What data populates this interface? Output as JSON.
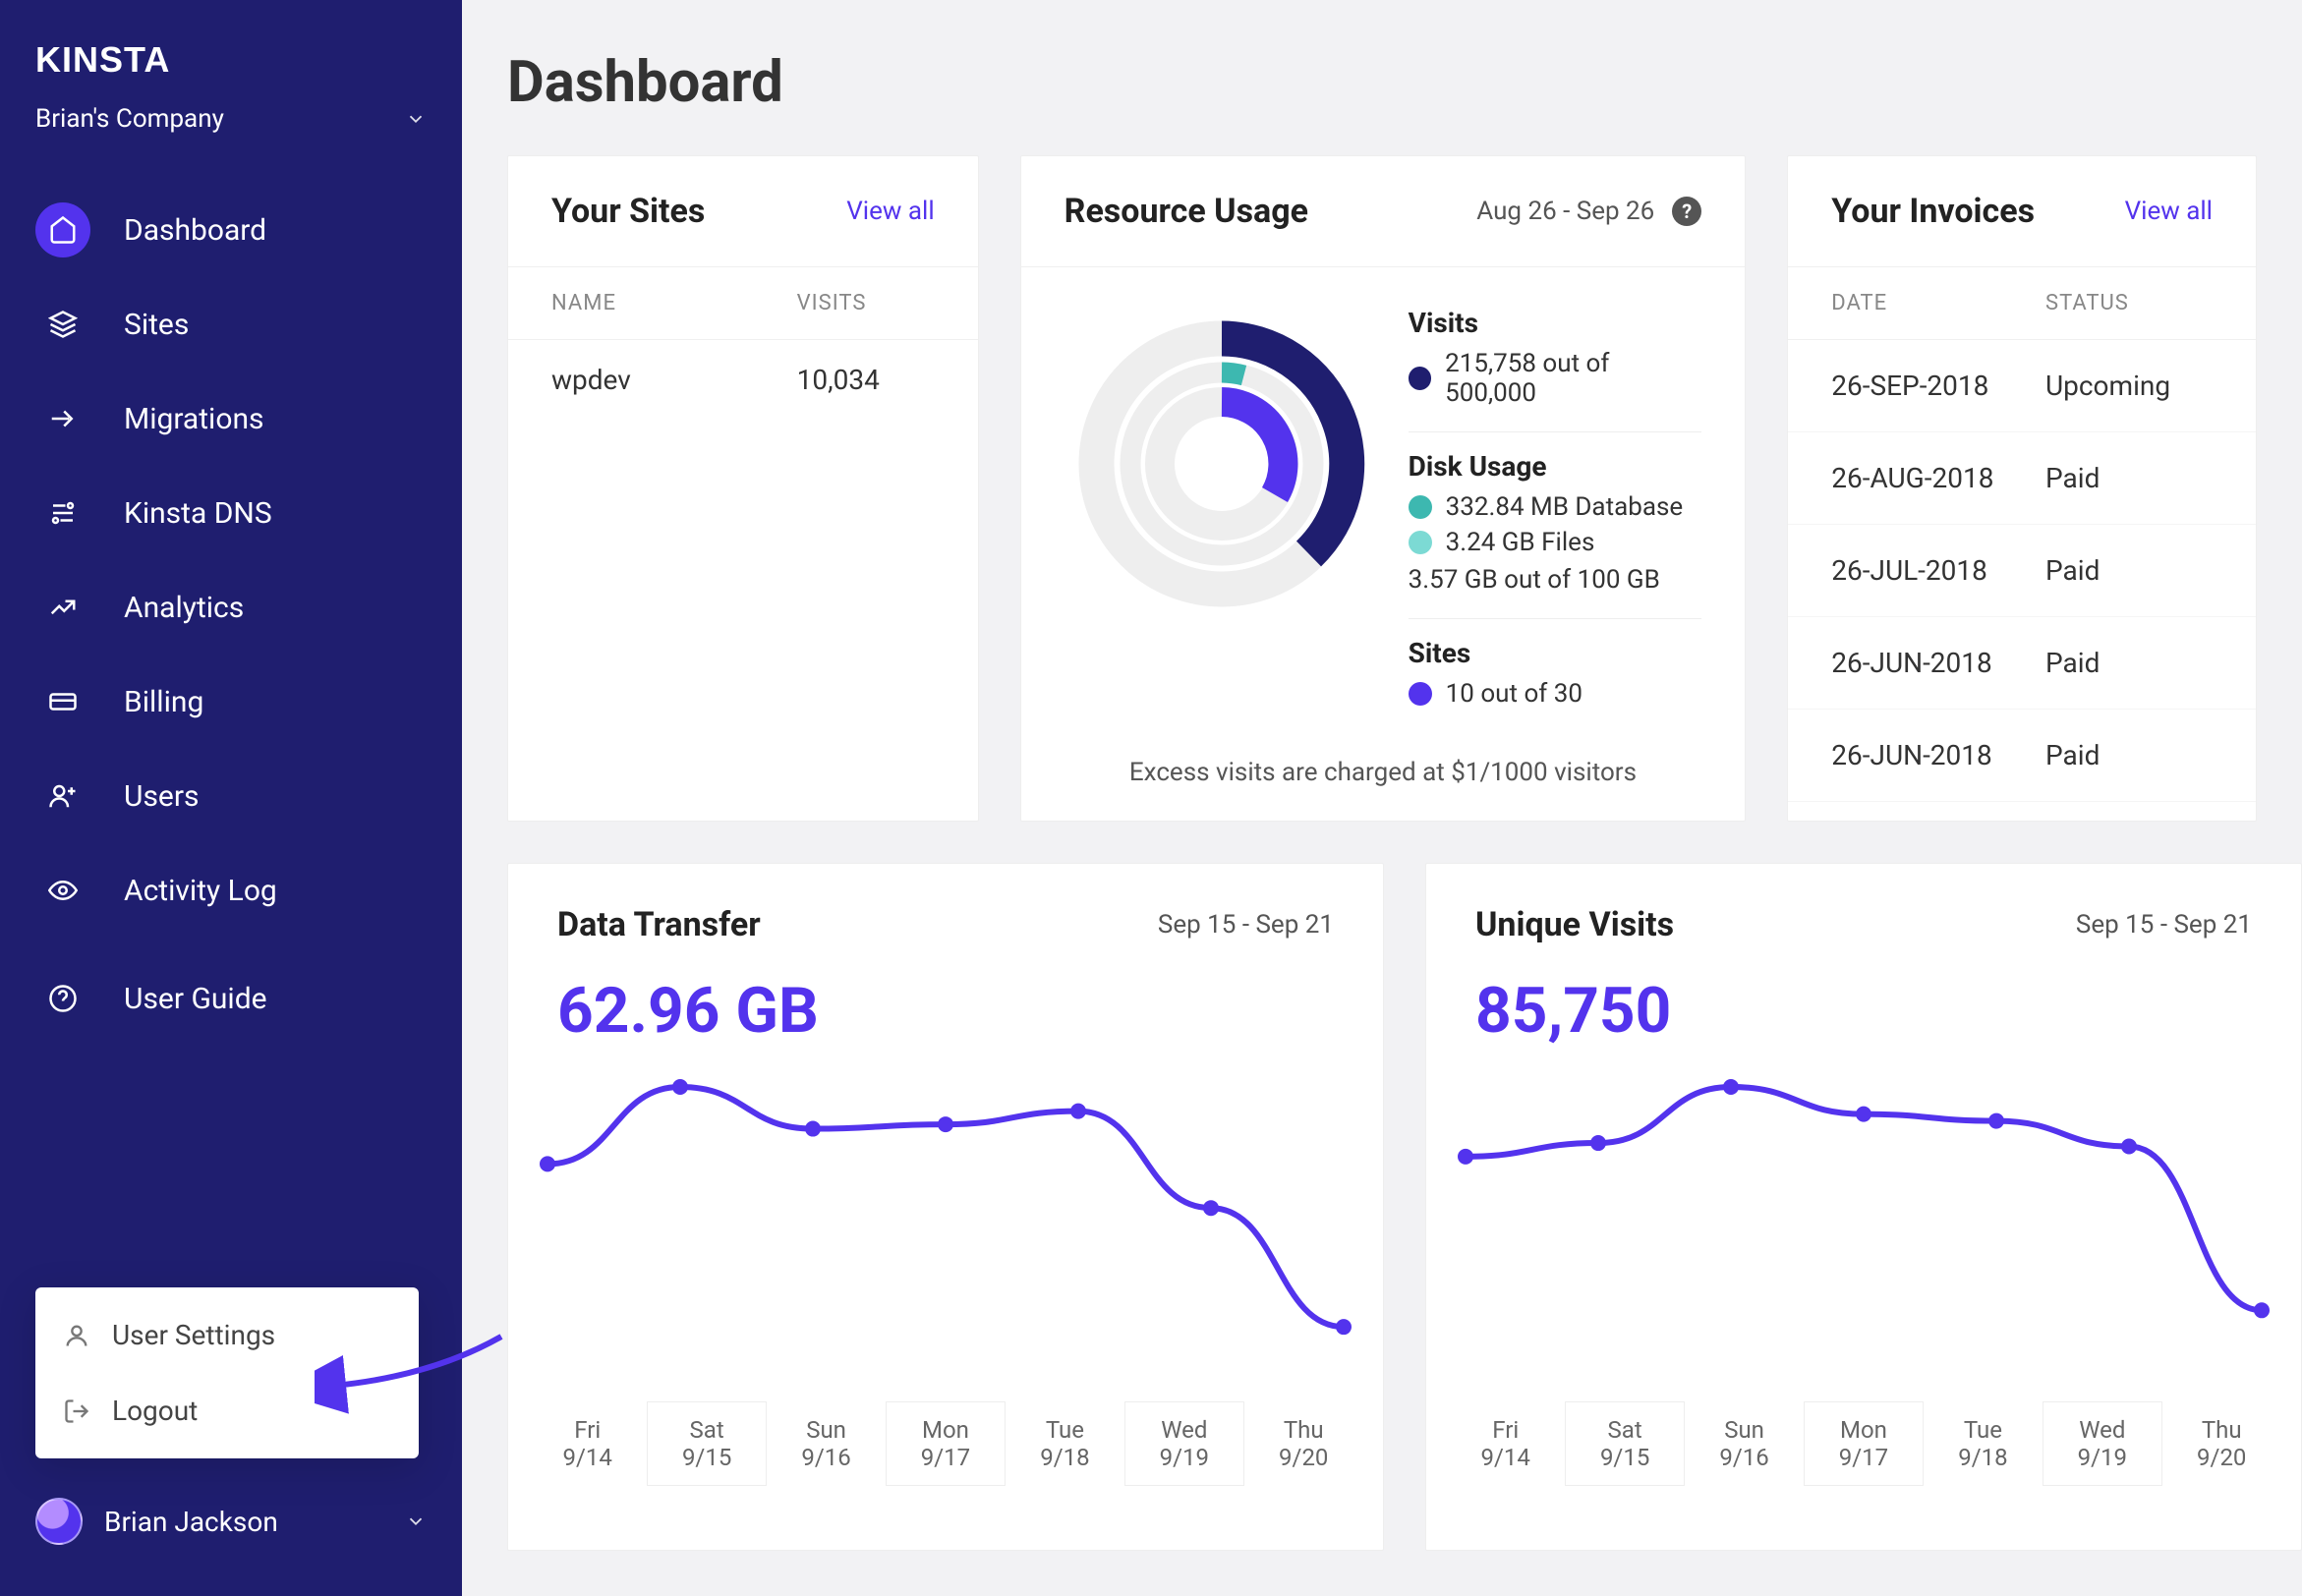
{
  "brand": "KINSTA",
  "company": {
    "name": "Brian's Company"
  },
  "sidebar": {
    "items": [
      {
        "label": "Dashboard"
      },
      {
        "label": "Sites"
      },
      {
        "label": "Migrations"
      },
      {
        "label": "Kinsta DNS"
      },
      {
        "label": "Analytics"
      },
      {
        "label": "Billing"
      },
      {
        "label": "Users"
      },
      {
        "label": "Activity Log"
      },
      {
        "label": "User Guide"
      }
    ]
  },
  "user_menu": {
    "settings": "User Settings",
    "logout": "Logout"
  },
  "user": {
    "name": "Brian Jackson"
  },
  "page": {
    "title": "Dashboard"
  },
  "sites_card": {
    "title": "Your Sites",
    "view_all": "View all",
    "head_name": "NAME",
    "head_visits": "VISITS",
    "rows": [
      {
        "name": "wpdev",
        "visits": "10,034"
      }
    ]
  },
  "resource_card": {
    "title": "Resource Usage",
    "range": "Aug 26 - Sep 26",
    "visits": {
      "title": "Visits",
      "main": "215,758 out of 500,000",
      "color": "#1f1e6f"
    },
    "disk": {
      "title": "Disk Usage",
      "db": "332.84 MB Database",
      "db_label": "Database",
      "files": "3.24 GB Files",
      "total": "3.57 GB out of 100 GB",
      "db_color": "#3db8b0",
      "files_color": "#7cdad4"
    },
    "sites": {
      "title": "Sites",
      "main": "10 out of 30",
      "color": "#5333ed"
    },
    "footer": "Excess visits are charged at $1/1000 visitors"
  },
  "invoices_card": {
    "title": "Your Invoices",
    "view_all": "View all",
    "head_date": "DATE",
    "head_status": "STATUS",
    "rows": [
      {
        "date": "26-SEP-2018",
        "status": "Upcoming"
      },
      {
        "date": "26-AUG-2018",
        "status": "Paid"
      },
      {
        "date": "26-JUL-2018",
        "status": "Paid"
      },
      {
        "date": "26-JUN-2018",
        "status": "Paid"
      },
      {
        "date": "26-JUN-2018",
        "status": "Paid"
      }
    ]
  },
  "transfer_card": {
    "title": "Data Transfer",
    "range": "Sep 15 - Sep 21",
    "big": "62.96 GB"
  },
  "unique_card": {
    "title": "Unique Visits",
    "range": "Sep 15 - Sep 21",
    "big": "85,750"
  },
  "xaxis": [
    {
      "dow": "Fri",
      "md": "9/14"
    },
    {
      "dow": "Sat",
      "md": "9/15"
    },
    {
      "dow": "Sun",
      "md": "9/16"
    },
    {
      "dow": "Mon",
      "md": "9/17"
    },
    {
      "dow": "Tue",
      "md": "9/18"
    },
    {
      "dow": "Wed",
      "md": "9/19"
    },
    {
      "dow": "Thu",
      "md": "9/20"
    }
  ],
  "chart_data": [
    {
      "type": "line",
      "title": "Data Transfer",
      "categories": [
        "9/14",
        "9/15",
        "9/16",
        "9/17",
        "9/18",
        "9/19",
        "9/20"
      ],
      "values": [
        9.0,
        12.5,
        10.6,
        10.8,
        11.4,
        7.0,
        1.6
      ],
      "ylabel": "GB",
      "total": 62.96
    },
    {
      "type": "line",
      "title": "Unique Visits",
      "categories": [
        "9/14",
        "9/15",
        "9/16",
        "9/17",
        "9/18",
        "9/19",
        "9/20"
      ],
      "values": [
        12100,
        12900,
        16200,
        14600,
        14200,
        12700,
        3050
      ],
      "total": 85750
    },
    {
      "type": "donut",
      "title": "Resource Usage",
      "rings": [
        {
          "name": "Visits",
          "value": 215758,
          "max": 500000,
          "color": "#1f1e6f"
        },
        {
          "name": "Sites",
          "value": 10,
          "max": 30,
          "color": "#5333ed"
        },
        {
          "name": "Disk Database GB",
          "value": 0.33,
          "max": 100,
          "color": "#3db8b0"
        },
        {
          "name": "Disk Files GB",
          "value": 3.24,
          "max": 100,
          "color": "#7cdad4"
        }
      ]
    }
  ]
}
